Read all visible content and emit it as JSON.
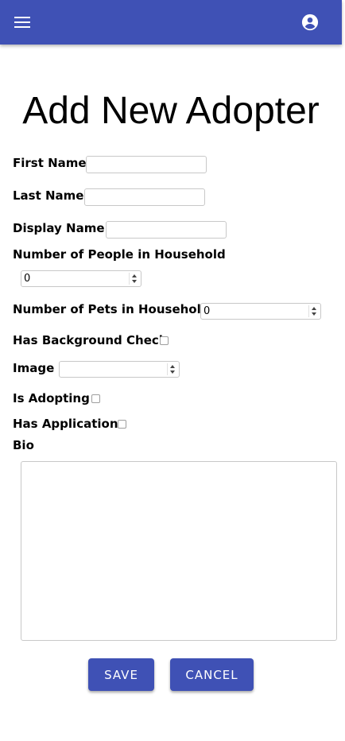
{
  "header": {
    "menu_icon": "menu-icon",
    "account_icon": "account-circle-icon",
    "bar_color": "#3f51b5"
  },
  "page": {
    "title": "Add New Adopter"
  },
  "form": {
    "first_name": {
      "label": "First Name",
      "value": ""
    },
    "last_name": {
      "label": "Last Name",
      "value": ""
    },
    "display_name": {
      "label": "Display Name",
      "value": ""
    },
    "people_in_household": {
      "label": "Number of People in Household",
      "value": "0"
    },
    "pets_in_household": {
      "label": "Number of Pets in Household",
      "value": "0"
    },
    "has_background_check": {
      "label": "Has Background Check",
      "checked": false
    },
    "image": {
      "label": "Image",
      "value": ""
    },
    "is_adopting": {
      "label": "Is Adopting",
      "checked": false
    },
    "has_application": {
      "label": "Has Application",
      "checked": false
    },
    "bio": {
      "label": "Bio",
      "value": ""
    }
  },
  "actions": {
    "save_label": "SAVE",
    "cancel_label": "CANCEL"
  }
}
